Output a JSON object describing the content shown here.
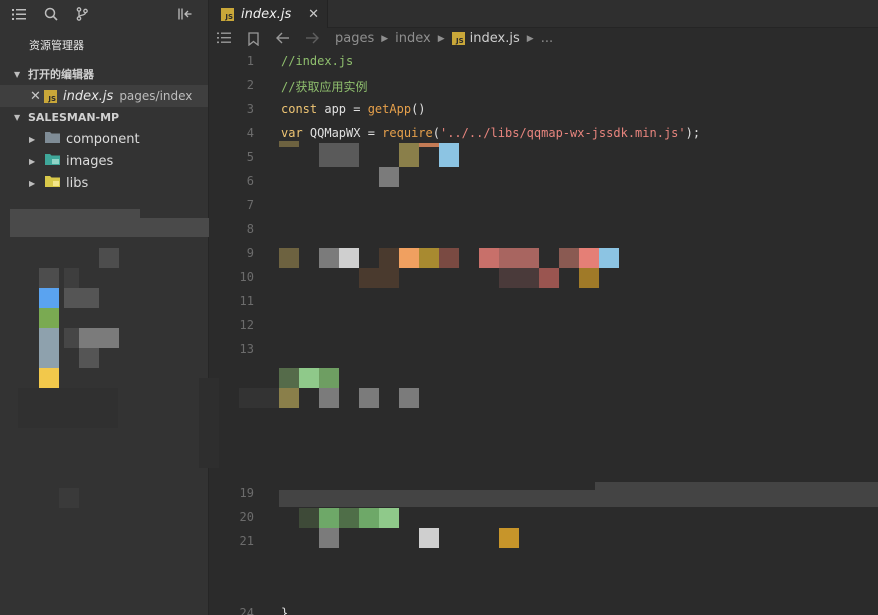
{
  "sidebar": {
    "explorer_title": "资源管理器",
    "open_editors_label": "打开的编辑器",
    "open_file_name": "index.js",
    "open_file_path": "pages/index",
    "project_label": "SALESMAN-MP",
    "tree": [
      {
        "label": "component",
        "icon": "folder-icon",
        "color": "#7f8c96"
      },
      {
        "label": "images",
        "icon": "images-folder-icon",
        "color": "#3fa79a"
      },
      {
        "label": "libs",
        "icon": "libs-folder-icon",
        "color": "#d9c94a"
      }
    ]
  },
  "editor": {
    "tab_label": "index.js",
    "breadcrumb": [
      "pages",
      "index",
      "index.js",
      "..."
    ],
    "lines": [
      {
        "n": "1"
      },
      {
        "n": "2"
      },
      {
        "n": "3"
      },
      {
        "n": "4"
      },
      {
        "n": "5"
      },
      {
        "n": "6"
      },
      {
        "n": "7"
      },
      {
        "n": "8"
      },
      {
        "n": "9"
      },
      {
        "n": "10"
      },
      {
        "n": "11"
      },
      {
        "n": "12"
      },
      {
        "n": "13"
      },
      {
        "n": "19"
      },
      {
        "n": "20"
      },
      {
        "n": "21"
      },
      {
        "n": "24"
      }
    ],
    "code": {
      "l1": "//index.js",
      "l2": "//获取应用实例",
      "l3_kw": "const",
      "l3_mid": " app = ",
      "l3_fn": "getApp",
      "l3_end": "()",
      "l4_kw": "var",
      "l4_mid": " QQMapWX = ",
      "l4_fn": "require",
      "l4_open": "(",
      "l4_str": "'../../libs/qqmap-wx-jssdk.min.js'",
      "l4_end": ");",
      "l24": "}"
    }
  },
  "colors": {
    "background": "#2b2b2b",
    "sidebar": "#333333",
    "comment": "#8fbf6e",
    "keyword": "#f0c674",
    "function": "#e6a04b",
    "string": "#e8857e",
    "js_icon": "#c9a739"
  }
}
